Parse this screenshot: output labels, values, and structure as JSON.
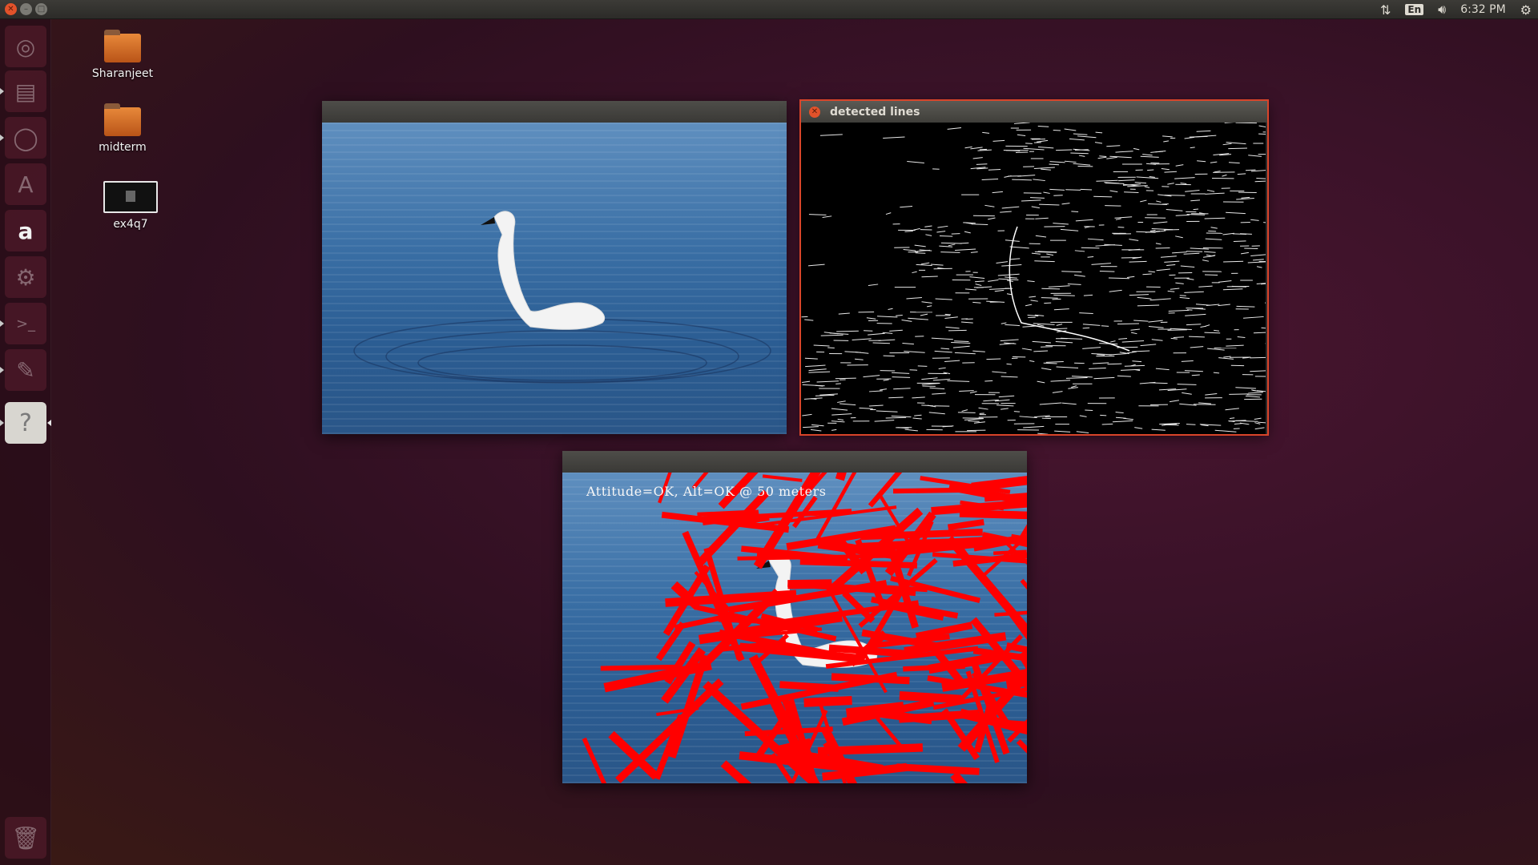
{
  "top_panel": {
    "network_icon": "network-transfer-icon",
    "keyboard_layout": "En",
    "volume_icon": "volume-icon",
    "clock": "6:32 PM",
    "session_icon": "gear-icon"
  },
  "launcher": {
    "items": [
      {
        "name": "dash-home",
        "icon": "ubuntu-logo-icon"
      },
      {
        "name": "files",
        "icon": "file-cabinet-icon"
      },
      {
        "name": "browser",
        "icon": "globe-icon"
      },
      {
        "name": "software-center",
        "icon": "shopping-bag-icon"
      },
      {
        "name": "amazon",
        "icon": "amazon-icon",
        "glyph": "a"
      },
      {
        "name": "system-settings",
        "icon": "gear-wrench-icon"
      },
      {
        "name": "terminal",
        "icon": "terminal-icon",
        "glyph": ">_"
      },
      {
        "name": "text-editor",
        "icon": "pencil-icon"
      },
      {
        "name": "unknown-app",
        "icon": "question-mark-icon",
        "glyph": "?"
      },
      {
        "name": "trash",
        "icon": "trash-icon"
      }
    ]
  },
  "desktop_icons": [
    {
      "label": "Sharanjeet",
      "type": "folder"
    },
    {
      "label": "midterm",
      "type": "folder"
    },
    {
      "label": "ex4q7",
      "type": "image"
    }
  ],
  "windows": {
    "source": {
      "title": ""
    },
    "detected_lines": {
      "title": "detected lines"
    },
    "result": {
      "title": "",
      "overlay_text": "Attitude=OK, Alt=OK @ 50 meters"
    }
  },
  "colors": {
    "accent_orange": "#e2522a",
    "line_red": "#ff0000"
  }
}
